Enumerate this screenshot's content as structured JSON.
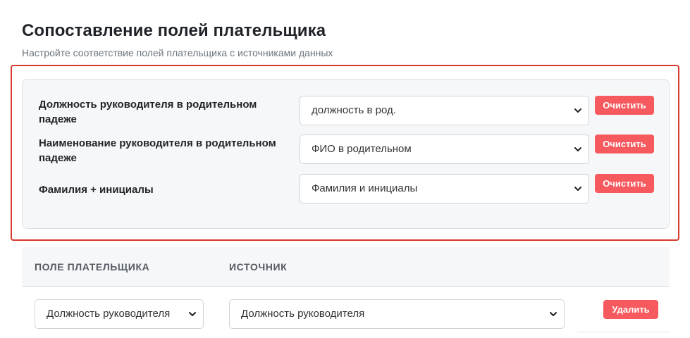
{
  "header": {
    "title": "Сопоставление полей плательщика",
    "subtitle": "Настройте соответствие полей плательщика с источниками данных"
  },
  "mappings": [
    {
      "label": "Должность руководителя в родительном падеже",
      "selected": "должность в род.",
      "clear_label": "Очистить"
    },
    {
      "label": "Наименование руководителя в родительном падеже",
      "selected": "ФИО в родительном",
      "clear_label": "Очистить"
    },
    {
      "label": "Фамилия + инициалы",
      "selected": "Фамилия и инициалы",
      "clear_label": "Очистить"
    }
  ],
  "table": {
    "columns": [
      "ПОЛЕ ПЛАТЕЛЬЩИКА",
      "ИСТОЧНИК"
    ],
    "rows": [
      {
        "field": "Должность руководителя",
        "source": "Должность руководителя",
        "delete_label": "Удалить"
      }
    ]
  },
  "icons": {
    "select_arrow": "chevron-down-icon"
  },
  "colors": {
    "danger": "#f75a5e",
    "highlight": "#d83a2e"
  }
}
